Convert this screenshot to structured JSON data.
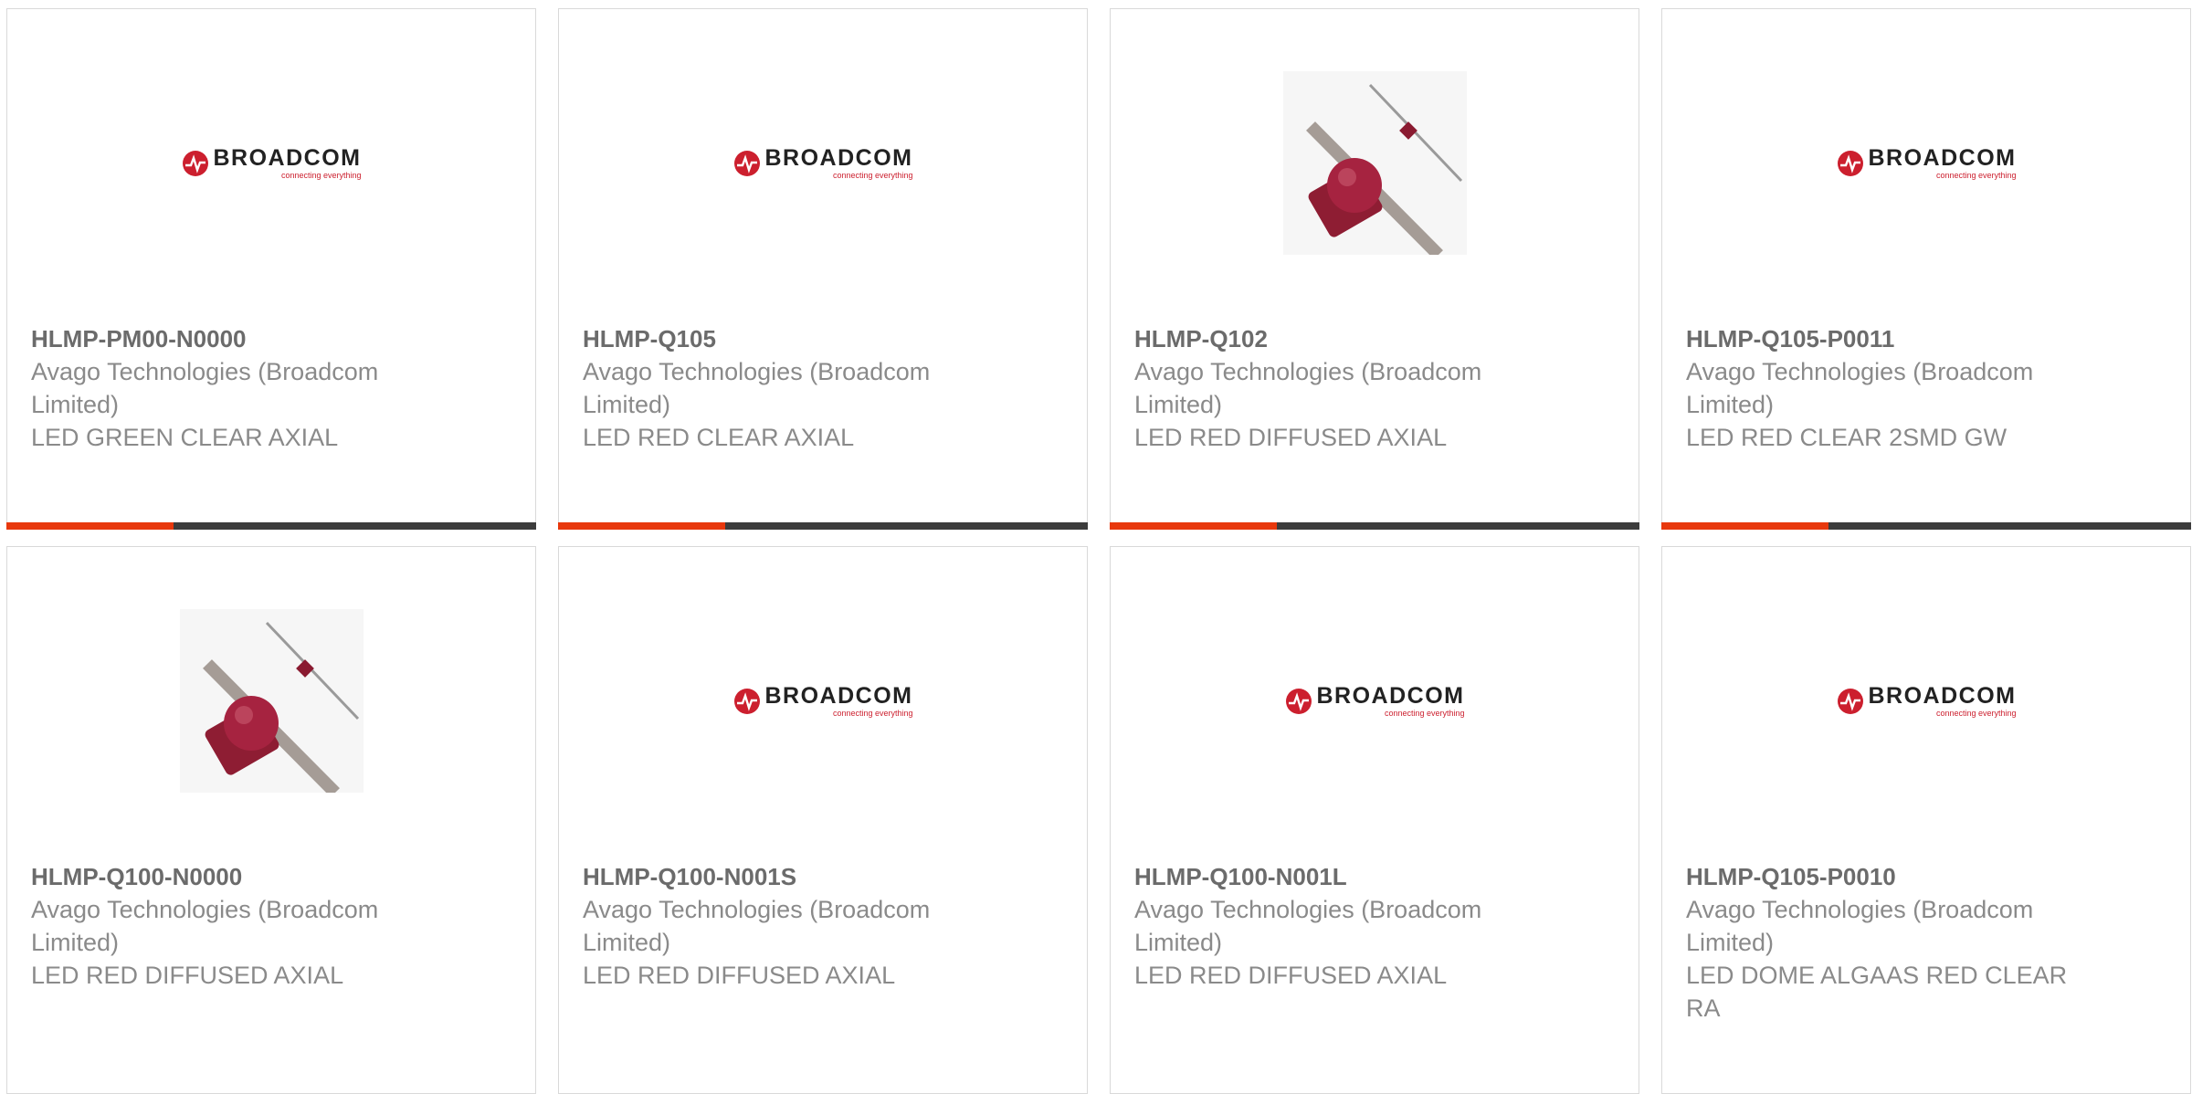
{
  "brand": {
    "logo_name": "BROADCOM",
    "logo_tagline": "connecting everything",
    "accent_color": "#e8380d",
    "brand_red": "#cc1f2e"
  },
  "products": [
    {
      "part_number": "HLMP-PM00-N0000",
      "manufacturer": "Avago Technologies (Broadcom Limited)",
      "description": "LED GREEN CLEAR AXIAL",
      "image": "broadcom-logo"
    },
    {
      "part_number": "HLMP-Q105",
      "manufacturer": "Avago Technologies (Broadcom Limited)",
      "description": "LED RED CLEAR AXIAL",
      "image": "broadcom-logo"
    },
    {
      "part_number": "HLMP-Q102",
      "manufacturer": "Avago Technologies (Broadcom Limited)",
      "description": "LED RED DIFFUSED AXIAL",
      "image": "led-photo"
    },
    {
      "part_number": "HLMP-Q105-P0011",
      "manufacturer": "Avago Technologies (Broadcom Limited)",
      "description": "LED RED CLEAR 2SMD GW",
      "image": "broadcom-logo"
    },
    {
      "part_number": "HLMP-Q100-N0000",
      "manufacturer": "Avago Technologies (Broadcom Limited)",
      "description": "LED RED DIFFUSED AXIAL",
      "image": "led-photo"
    },
    {
      "part_number": "HLMP-Q100-N001S",
      "manufacturer": "Avago Technologies (Broadcom Limited)",
      "description": "LED RED DIFFUSED AXIAL",
      "image": "broadcom-logo"
    },
    {
      "part_number": "HLMP-Q100-N001L",
      "manufacturer": "Avago Technologies (Broadcom Limited)",
      "description": "LED RED DIFFUSED AXIAL",
      "image": "broadcom-logo"
    },
    {
      "part_number": "HLMP-Q105-P0010",
      "manufacturer": "Avago Technologies (Broadcom Limited)",
      "description": "LED DOME ALGAAS RED CLEAR RA",
      "image": "broadcom-logo"
    }
  ]
}
